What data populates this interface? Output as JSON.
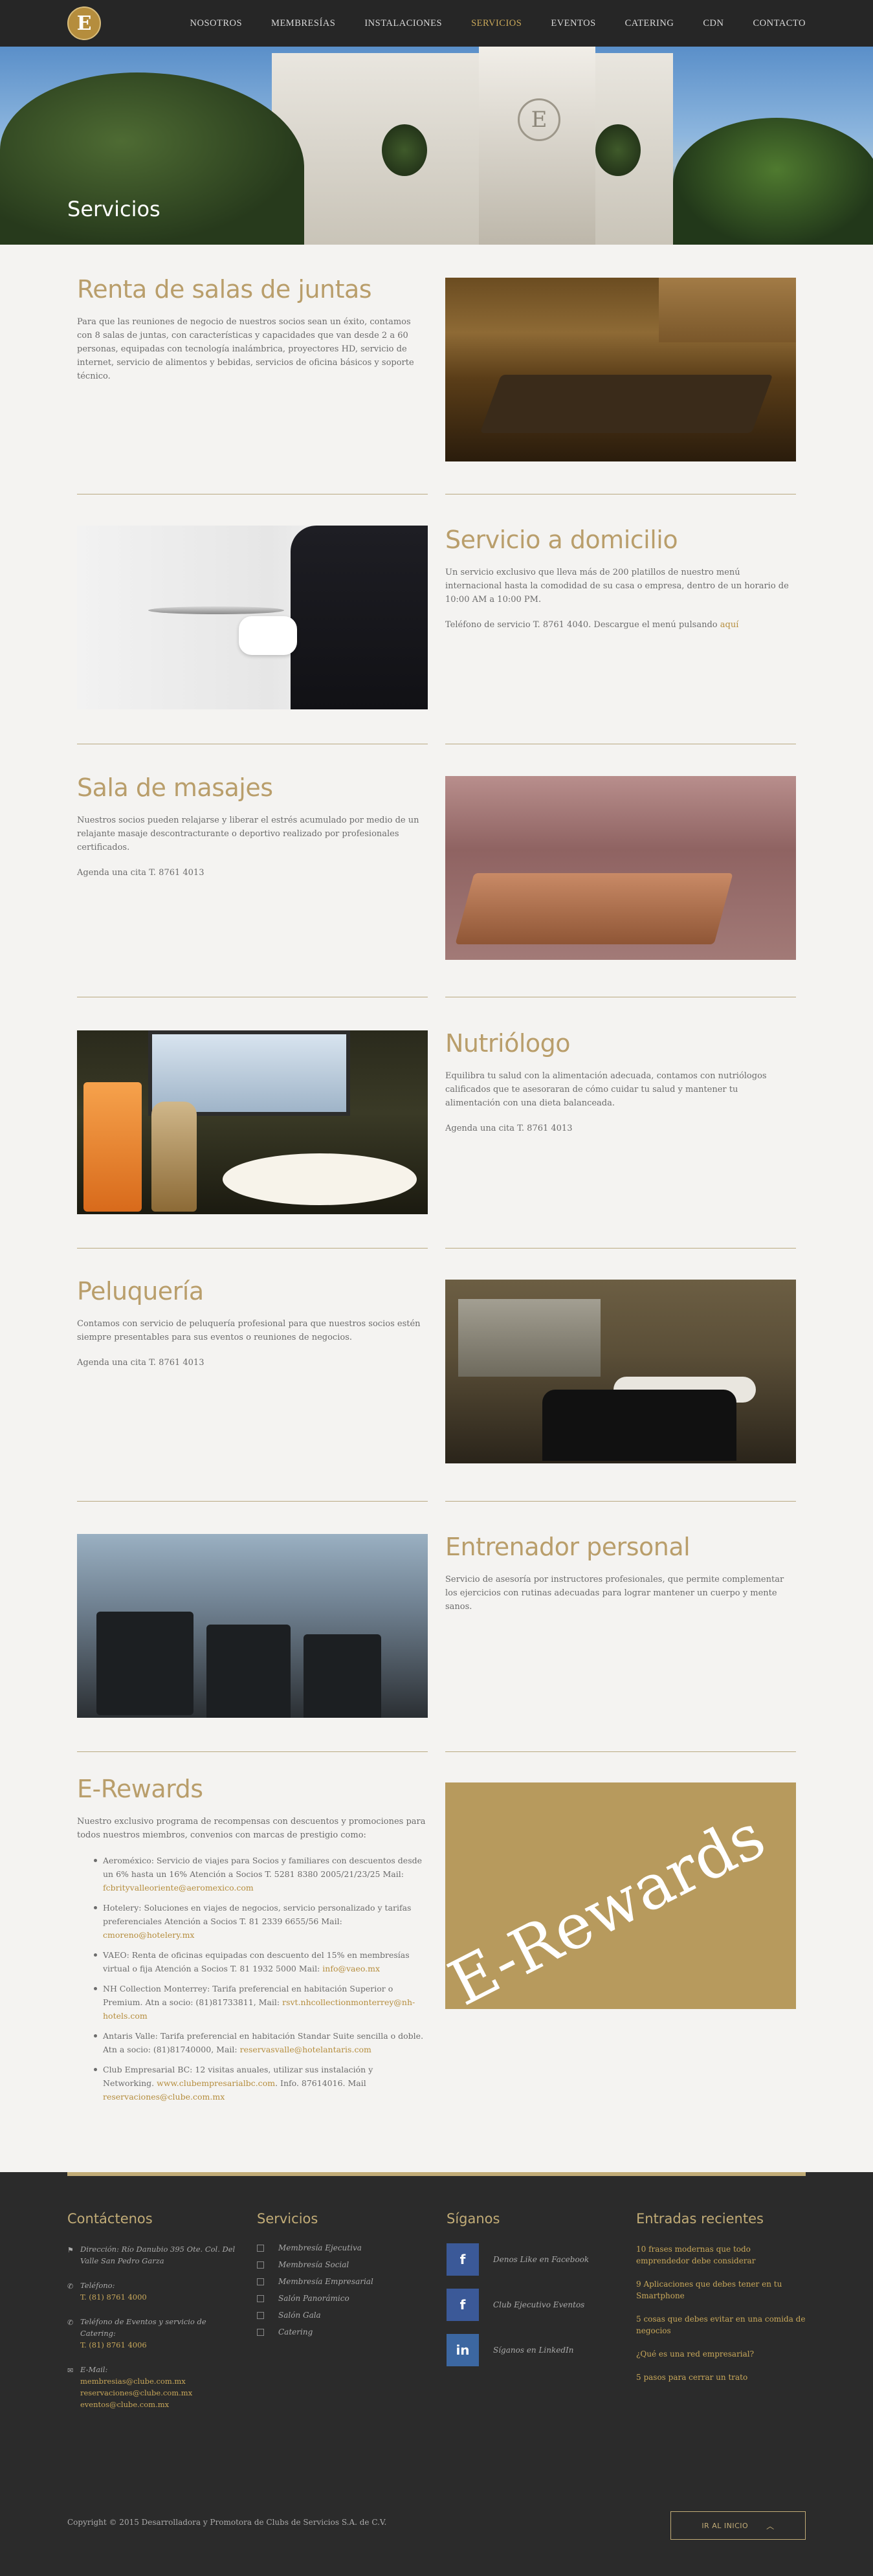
{
  "header": {
    "logo_letter": "E",
    "nav": [
      "NOSOTROS",
      "MEMBRESÍAS",
      "INSTALACIONES",
      "SERVICIOS",
      "EVENTOS",
      "CATERING",
      "CDN",
      "CONTACTO"
    ],
    "active": "SERVICIOS"
  },
  "hero": {
    "title": "Servicios",
    "emblem": "E"
  },
  "sections": {
    "salas": {
      "title": "Renta de salas de juntas",
      "body": "Para que las reuniones de negocio de nuestros socios sean un éxito, contamos con 8 salas de juntas, con características y capacidades que van desde 2 a 60 personas, equipadas con tecnología inalámbrica, proyectores HD, servicio de internet, servicio de alimentos y bebidas, servicios de oficina básicos y soporte técnico."
    },
    "domicilio": {
      "title": "Servicio a domicilio",
      "body": "Un servicio exclusivo que lleva  más de 200 platillos de nuestro menú internacional hasta la comodidad de su casa o empresa, dentro de un horario de 10:00 AM a 10:00 PM.",
      "phone_text": "Teléfono de servicio T. 8761 4040. Descargue el menú pulsando",
      "link": "aquí"
    },
    "masajes": {
      "title": "Sala de masajes",
      "body": "Nuestros socios pueden relajarse y liberar el estrés acumulado por medio de un relajante masaje descontracturante o deportivo realizado por profesionales certificados.",
      "cita": "Agenda una cita T. 8761 4013"
    },
    "nutriologo": {
      "title": "Nutriólogo",
      "body": "Equilibra tu salud con la alimentación adecuada, contamos con nutriólogos calificados que te asesoraran de cómo cuidar tu salud y mantener tu alimentación con una dieta balanceada.",
      "cita": "Agenda una cita T. 8761 4013"
    },
    "peluqueria": {
      "title": "Peluquería",
      "body": "Contamos con servicio de peluquería profesional para que nuestros socios estén siempre presentables para sus eventos o reuniones de negocios.",
      "cita": "Agenda una cita T. 8761 4013"
    },
    "entrenador": {
      "title": "Entrenador personal",
      "body": "Servicio de asesoría por instructores profesionales, que permite complementar los ejercicios con rutinas adecuadas para lograr mantener un cuerpo y mente sanos."
    },
    "erewards": {
      "title": "E-Rewards",
      "intro": "Nuestro exclusivo programa de recompensas con descuentos y promociones para todos nuestros miembros, convenios con marcas de prestigio como:",
      "image_word": "E-Rewards",
      "items": [
        {
          "text": "Aeroméxico: Servicio de viajes para Socios y familiares con descuentos desde un 6% hasta un 16%       Atención a Socios  T. 5281 8380 2005/21/23/25 Mail:",
          "link": "fcbrityvalleoriente@aeromexico.com"
        },
        {
          "text": "Hotelery: Soluciones en viajes de negocios, servicio personalizado y tarifas preferenciales      Atención a Socios  T. 81 2339 6655/56  Mail:",
          "link": "cmoreno@hotelery.mx"
        },
        {
          "text": "VAEO: Renta de oficinas equipadas con descuento del 15% en membresías virtual o fija       Atención a Socios  T. 81 1932 5000  Mail:",
          "link": "info@vaeo.mx"
        },
        {
          "text": "NH Collection Monterrey: Tarifa preferencial en habitación Superior o Premium.   Atn a socio: (81)81733811, Mail:",
          "link": "rsvt.nhcollectionmonterrey@nh-hotels.com"
        },
        {
          "text": "Antaris Valle: Tarifa preferencial en habitación Standar Suite sencilla o doble.  Atn a socio: (81)81740000, Mail:",
          "link": "reservasvalle@hotelantaris.com"
        },
        {
          "text": "Club Empresarial BC: 12 visitas anuales, utilizar sus instalación y Networking.",
          "link": "www.clubempresarialbc.com",
          "tail": ". Info. 87614016. Mail",
          "link2": "reservaciones@clube.com.mx"
        }
      ]
    }
  },
  "footer": {
    "contact": {
      "title": "Contáctenos",
      "address": "Dirección: Río Danubio 395 Ote. Col. Del Valle San Pedro Garza",
      "tel_label": "Teléfono:",
      "tel": "T. (81) 8761 4000",
      "cat_label": "Teléfono de Eventos y servicio de Catering:",
      "cat": "T. (81) 8761 4006",
      "email_label": "E-Mail:",
      "emails": [
        "membresias@clube.com.mx",
        "reservaciones@clube.com.mx",
        "eventos@clube.com.mx"
      ]
    },
    "services": {
      "title": "Servicios",
      "items": [
        "Membresía Ejecutiva",
        "Membresía Social",
        "Membresía Empresarial",
        "Salón Panorámico",
        "Salón Gala",
        "Catering"
      ]
    },
    "follow": {
      "title": "Síganos",
      "items": [
        {
          "icon": "f",
          "label": "Denos Like en Facebook"
        },
        {
          "icon": "f",
          "label": "Club Ejecutivo Eventos"
        },
        {
          "icon": "in",
          "label": "Síganos en LinkedIn"
        }
      ]
    },
    "posts": {
      "title": "Entradas recientes",
      "items": [
        "10 frases modernas que todo emprendedor debe considerar",
        "9 Aplicaciones que debes tener en tu Smartphone",
        "5 cosas que debes evitar en una comida de negocios",
        "¿Qué es una red empresarial?",
        "5 pasos para cerrar un trato"
      ]
    },
    "copyright": "Copyright © 2015 Desarrolladora y Promotora de Clubs de Servicios S.A. de C.V.",
    "to_top": "IR AL INICIO"
  },
  "colors": {
    "gold": "#b58d3d",
    "heading": "#b99e6b",
    "dark": "#262626",
    "footer": "#2b2b2b"
  }
}
